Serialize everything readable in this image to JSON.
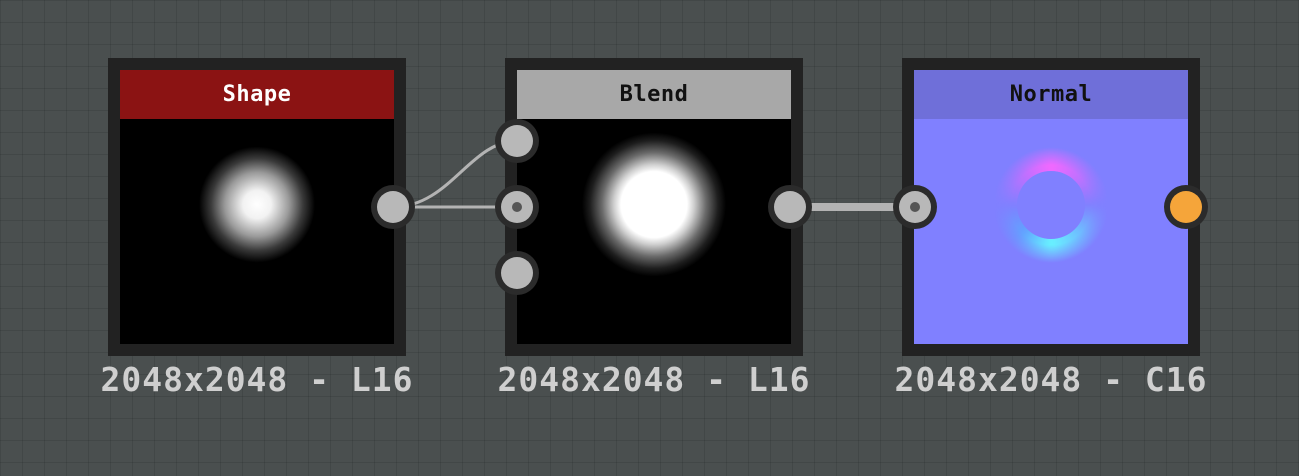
{
  "graph": {
    "nodes": [
      {
        "id": "shape",
        "title": "Shape",
        "header_color": "#8b1313",
        "preview": "soft white radial blob on black (grayscale)",
        "resolution_label": "2048x2048 - L16"
      },
      {
        "id": "blend",
        "title": "Blend",
        "header_color": "#a8a8a8",
        "preview": "bright white disc with glow on black (grayscale)",
        "resolution_label": "2048x2048 - L16"
      },
      {
        "id": "normal",
        "title": "Normal",
        "header_color": "#6f6fd9",
        "preview": "normal map: blue-violet with colored ring",
        "resolution_label": "2048x2048 - C16"
      }
    ],
    "colors": {
      "canvas_background": "#4a4f4f",
      "port_fill": "#b8b8b8",
      "output_port_active": "#f5a53a",
      "link": "#b3b3b3"
    }
  }
}
